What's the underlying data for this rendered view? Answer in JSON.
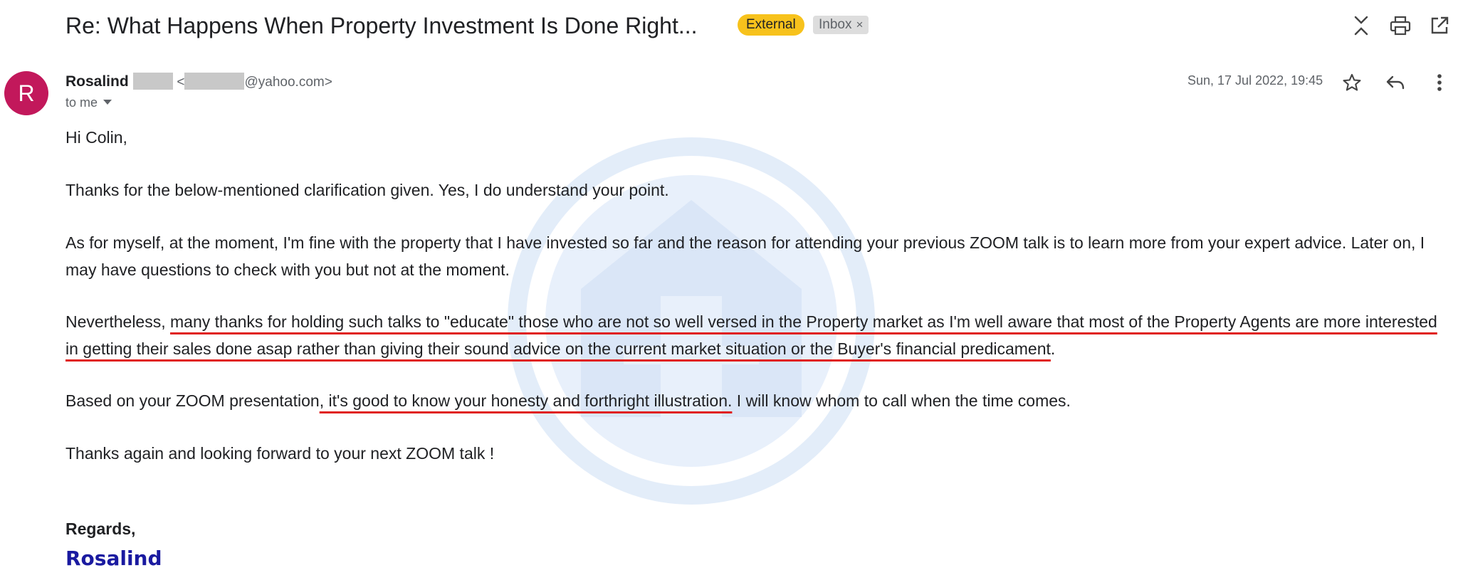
{
  "header": {
    "subject": "Re: What Happens When Property Investment Is Done Right...",
    "label_external": "External",
    "label_inbox": "Inbox",
    "label_remove": "×",
    "icons": [
      "expand-collapse-icon",
      "print-icon",
      "open-new-window-icon"
    ]
  },
  "message": {
    "avatar_letter": "R",
    "avatar_color": "#c2185b",
    "sender_name": "Rosalind",
    "sender_email_open": "<",
    "sender_email_domain": "@yahoo.com>",
    "recipient": "to me",
    "date": "Sun, 17 Jul 2022, 19:45",
    "icons": [
      "star-icon",
      "reply-icon",
      "more-vert-icon"
    ]
  },
  "body": {
    "greeting": "Hi Colin,",
    "p1": "Thanks for the below-mentioned clarification given.  Yes, I do understand your point.",
    "p2": "As for myself, at the moment, I'm fine with the property that I have invested so far and the reason for attending your previous ZOOM talk is to learn more from your expert advice. Later on, I may have questions to check with you but not at the moment.",
    "p3_before": "Nevertheless, ",
    "p3_underlined": "many thanks for holding such talks to \"educate\" those who are not so well versed in the Property market as I'm well aware that most of the Property Agents are more interested in getting their sales done asap rather than giving their sound advice on the current market situation or the Buyer's financial predicament",
    "p3_after": ".",
    "p4_before": "Based on your ZOOM presentation",
    "p4_underlined": ", it's good to know your honesty and forthright illustration.",
    "p4_after": "  I will know whom to call when the time comes.",
    "p5": "Thanks again and looking forward to your next ZOOM talk !",
    "regards": "Regards,",
    "signature": "Rosalind"
  },
  "colors": {
    "external_badge": "#f7c21c",
    "inbox_badge": "#dddddd",
    "underline": "#e0201c",
    "signature": "#1a1aa0",
    "watermark": "#e3edf9"
  }
}
